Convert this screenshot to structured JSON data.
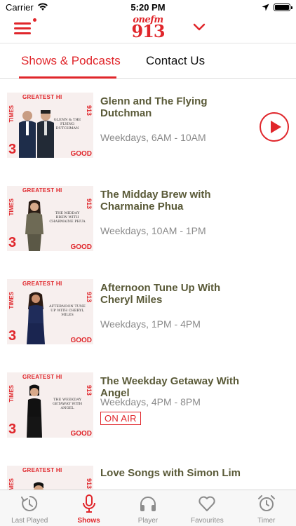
{
  "status_bar": {
    "carrier": "Carrier",
    "time": "5:20 PM"
  },
  "header": {
    "logo_top": "onefm",
    "logo_bottom": "913"
  },
  "tabs": [
    {
      "label": "Shows & Podcasts"
    },
    {
      "label": "Contact Us"
    }
  ],
  "thumbnail_text": {
    "top": "GREATEST HI",
    "left": "TIMES",
    "right": "913",
    "bottom_left": "3",
    "bottom_right": "GOOD"
  },
  "shows": [
    {
      "title": "Glenn and The Flying Dutchman",
      "time": "Weekdays, 6AM - 10AM",
      "caption": "GLENN & THE FLYING DUTCHMAN"
    },
    {
      "title": "The Midday Brew with Charmaine Phua",
      "time": "Weekdays, 10AM - 1PM",
      "caption": "THE MIDDAY BREW WITH CHARMAINE PHUA"
    },
    {
      "title": "Afternoon Tune Up With Cheryl Miles",
      "time": "Weekdays, 1PM - 4PM",
      "caption": "AFTERNOON TUNE UP WITH CHERYL MILES"
    },
    {
      "title": "The Weekday Getaway With Angel",
      "time": "Weekdays, 4PM - 8PM",
      "caption": "THE WEEKDAY GETAWAY WITH ANGEL",
      "badge": "ON AIR"
    },
    {
      "title": "Love Songs with Simon Lim",
      "time": "",
      "caption": ""
    }
  ],
  "tab_bar": [
    {
      "label": "Last Played",
      "icon": "history-icon"
    },
    {
      "label": "Shows",
      "icon": "microphone-icon"
    },
    {
      "label": "Player",
      "icon": "headphones-icon"
    },
    {
      "label": "Favourites",
      "icon": "heart-icon"
    },
    {
      "label": "Timer",
      "icon": "alarm-clock-icon"
    }
  ],
  "colors": {
    "accent": "#e0262b",
    "title": "#5a5a38",
    "muted": "#8a8a8a"
  }
}
